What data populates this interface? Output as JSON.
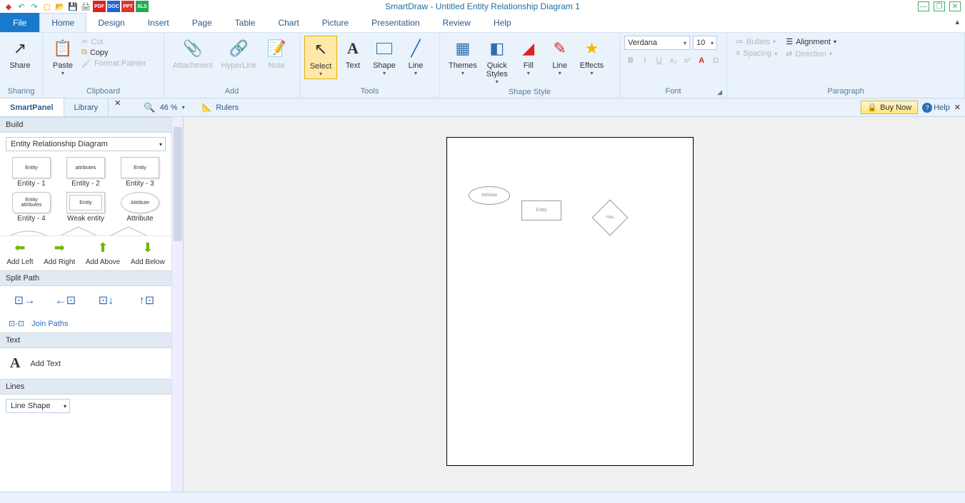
{
  "app_title": "SmartDraw - Untitled Entity Relationship Diagram 1",
  "menu": {
    "file": "File",
    "tabs": [
      "Home",
      "Design",
      "Insert",
      "Page",
      "Table",
      "Chart",
      "Picture",
      "Presentation",
      "Review",
      "Help"
    ]
  },
  "ribbon": {
    "sharing": {
      "label": "Sharing",
      "share": "Share"
    },
    "clipboard": {
      "label": "Clipboard",
      "paste": "Paste",
      "cut": "Cut",
      "copy": "Copy",
      "fmt": "Format Painter"
    },
    "add": {
      "label": "Add",
      "attachment": "Attachment",
      "hyperlink": "HyperLink",
      "note": "Note"
    },
    "tools": {
      "label": "Tools",
      "select": "Select",
      "text": "Text",
      "shape": "Shape",
      "line": "Line"
    },
    "shapestyle": {
      "label": "Shape Style",
      "themes": "Themes",
      "quick": "Quick\nStyles",
      "fill": "Fill",
      "line": "Line",
      "effects": "Effects"
    },
    "font": {
      "label": "Font",
      "name": "Verdana",
      "size": "10"
    },
    "para": {
      "label": "Paragraph",
      "bullets": "Bullets",
      "spacing": "Spacing",
      "alignment": "Alignment",
      "direction": "Direction"
    }
  },
  "subbar": {
    "smartpanel": "SmartPanel",
    "library": "Library",
    "zoom": "46 %",
    "rulers": "Rulers",
    "buy": "Buy Now",
    "help": "Help"
  },
  "side": {
    "build": "Build",
    "template": "Entity Relationship Diagram",
    "row1": {
      "s1": "Entity",
      "s2": "attributes",
      "s3": "Entity"
    },
    "lab1": [
      "Entity - 1",
      "Entity - 2",
      "Entity - 3"
    ],
    "row2": {
      "s1a": "Entity",
      "s1b": "attributes",
      "s2": "Entity",
      "s3": "Attribute"
    },
    "lab2": [
      "Entity - 4",
      "Weak entity",
      "Attribute"
    ],
    "add": {
      "left": "Add Left",
      "right": "Add Right",
      "above": "Add Above",
      "below": "Add Below"
    },
    "split": "Split Path",
    "join": "Join Paths",
    "text_h": "Text",
    "addtext": "Add Text",
    "lines_h": "Lines",
    "lineshape": "Line Shape"
  },
  "canvas": {
    "attr": "Attribute",
    "entity": "Entity",
    "rel": "Has"
  }
}
